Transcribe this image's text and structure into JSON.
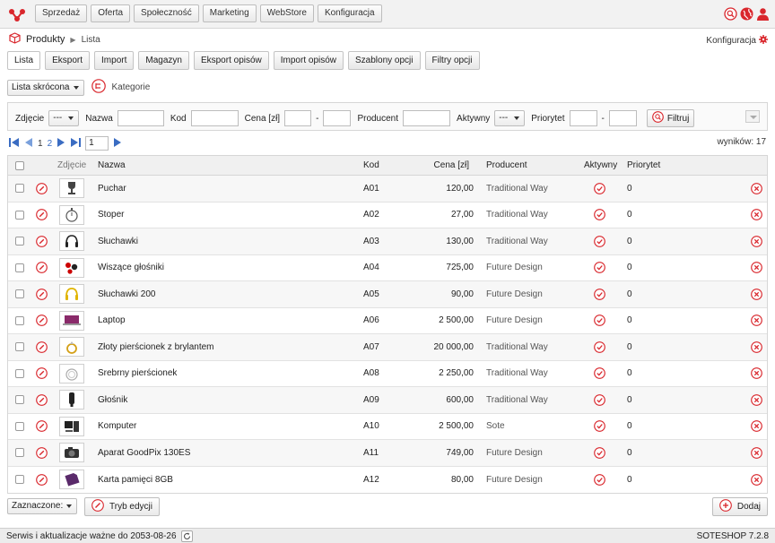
{
  "top_menu": [
    "Sprzedaż",
    "Oferta",
    "Społeczność",
    "Marketing",
    "WebStore",
    "Konfiguracja"
  ],
  "breadcrumb": {
    "title": "Produkty",
    "sub": "Lista"
  },
  "config_label": "Konfiguracja",
  "tabs": [
    "Lista",
    "Eksport",
    "Import",
    "Magazyn",
    "Eksport opisów",
    "Import opisów",
    "Szablony opcji",
    "Filtry opcji"
  ],
  "view": {
    "selected": "Lista skrócona",
    "categories_label": "Kategorie"
  },
  "filters": {
    "photo_label": "Zdjęcie",
    "photo_value": "---",
    "name_label": "Nazwa",
    "code_label": "Kod",
    "price_label": "Cena [zł]",
    "dash": "-",
    "producer_label": "Producent",
    "active_label": "Aktywny",
    "active_value": "---",
    "priority_label": "Priorytet",
    "filter_button": "Filtruj"
  },
  "pager": {
    "page1": "1",
    "page2": "2",
    "page_input": "1",
    "results": "wyników: 17"
  },
  "columns": {
    "photo": "Zdjęcie",
    "name": "Nazwa",
    "code": "Kod",
    "price": "Cena [zł]",
    "producer": "Producent",
    "active": "Aktywny",
    "priority": "Priorytet"
  },
  "rows": [
    {
      "name": "Puchar",
      "code": "A01",
      "price": "120,00",
      "producer": "Traditional Way",
      "priority": "0",
      "thumb": "trophy"
    },
    {
      "name": "Stoper",
      "code": "A02",
      "price": "27,00",
      "producer": "Traditional Way",
      "priority": "0",
      "thumb": "stopwatch"
    },
    {
      "name": "Słuchawki",
      "code": "A03",
      "price": "130,00",
      "producer": "Traditional Way",
      "priority": "0",
      "thumb": "headphones"
    },
    {
      "name": "Wiszące głośniki",
      "code": "A04",
      "price": "725,00",
      "producer": "Future Design",
      "priority": "0",
      "thumb": "speakers"
    },
    {
      "name": "Słuchawki 200",
      "code": "A05",
      "price": "90,00",
      "producer": "Future Design",
      "priority": "0",
      "thumb": "headphones-yellow"
    },
    {
      "name": "Laptop",
      "code": "A06",
      "price": "2 500,00",
      "producer": "Future Design",
      "priority": "0",
      "thumb": "laptop"
    },
    {
      "name": "Złoty pierścionek z brylantem",
      "code": "A07",
      "price": "20 000,00",
      "producer": "Traditional Way",
      "priority": "0",
      "thumb": "gold-ring"
    },
    {
      "name": "Srebrny pierścionek",
      "code": "A08",
      "price": "2 250,00",
      "producer": "Traditional Way",
      "priority": "0",
      "thumb": "silver-ring"
    },
    {
      "name": "Głośnik",
      "code": "A09",
      "price": "600,00",
      "producer": "Traditional Way",
      "priority": "0",
      "thumb": "speaker"
    },
    {
      "name": "Komputer",
      "code": "A10",
      "price": "2 500,00",
      "producer": "Sote",
      "priority": "0",
      "thumb": "computer"
    },
    {
      "name": "Aparat GoodPix 130ES",
      "code": "A11",
      "price": "749,00",
      "producer": "Future Design",
      "priority": "0",
      "thumb": "camera"
    },
    {
      "name": "Karta pamięci 8GB",
      "code": "A12",
      "price": "80,00",
      "producer": "Future Design",
      "priority": "0",
      "thumb": "memory-card"
    }
  ],
  "bottom": {
    "selected_label": "Zaznaczone:",
    "edit_mode": "Tryb edycji",
    "add": "Dodaj"
  },
  "status": {
    "left": "Serwis i aktualizacje ważne do 2053-08-26",
    "right": "SOTESHOP 7.2.8"
  },
  "colors": {
    "accent": "#d9262c",
    "link": "#3a6cc2",
    "pager_blue": "#3a6cc2"
  }
}
